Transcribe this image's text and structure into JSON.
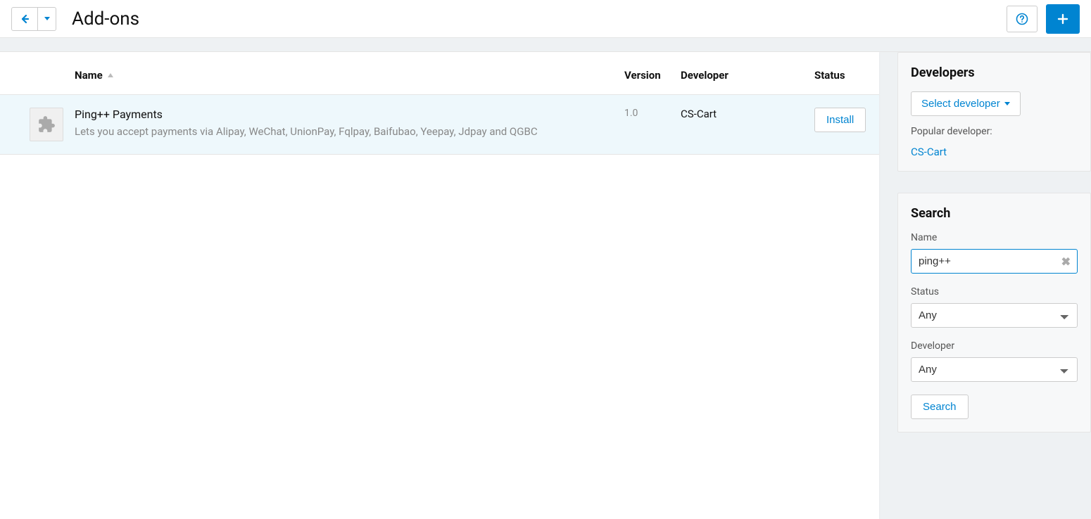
{
  "header": {
    "title": "Add-ons"
  },
  "table": {
    "columns": {
      "name": "Name",
      "version": "Version",
      "developer": "Developer",
      "status": "Status"
    },
    "rows": [
      {
        "name": "Ping++ Payments",
        "description": "Lets you accept payments via Alipay, WeChat, UnionPay, Fqlpay, Baifubao, Yeepay, Jdpay and QGBC",
        "version": "1.0",
        "developer": "CS-Cart",
        "action": "Install"
      }
    ]
  },
  "sidebar": {
    "developers": {
      "heading": "Developers",
      "select_label": "Select developer",
      "popular_label": "Popular developer:",
      "popular": [
        "CS-Cart"
      ]
    },
    "search": {
      "heading": "Search",
      "name_label": "Name",
      "name_value": "ping++",
      "status_label": "Status",
      "status_value": "Any",
      "developer_label": "Developer",
      "developer_value": "Any",
      "button": "Search"
    }
  }
}
